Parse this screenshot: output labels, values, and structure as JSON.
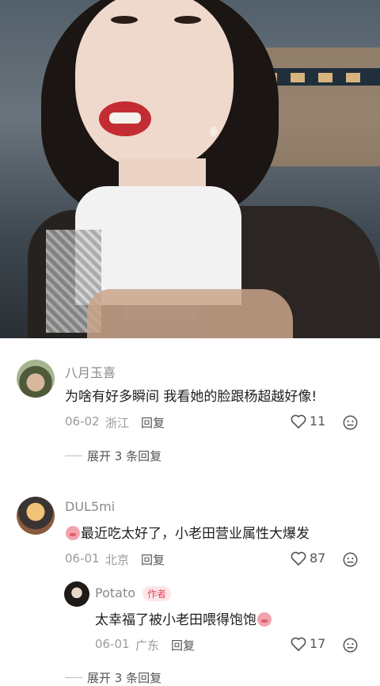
{
  "comments": [
    {
      "username": "八月玉喜",
      "text": "为啥有好多瞬间 我看她的脸跟杨超越好像!",
      "date": "06-02",
      "location": "浙江",
      "reply_label": "回复",
      "likes": "11",
      "expand_label": "展开 3 条回复"
    },
    {
      "username": "DUL5mi",
      "text": "最近吃太好了，小老田营业属性大爆发",
      "date": "06-01",
      "location": "北京",
      "reply_label": "回复",
      "likes": "87",
      "reply": {
        "username": "Potato",
        "author_tag": "作者",
        "text": "太幸福了被小老田喂得饱饱",
        "date": "06-01",
        "location": "广东",
        "reply_label": "回复",
        "likes": "17"
      },
      "expand_label": "展开 3 条回复"
    }
  ],
  "colors": {
    "like_icon": "#555555",
    "author_tag": "#e8455a",
    "meta_text": "#9b9b9b"
  },
  "icons": {
    "like": "heart-icon",
    "dislike": "dislike-face-icon"
  }
}
